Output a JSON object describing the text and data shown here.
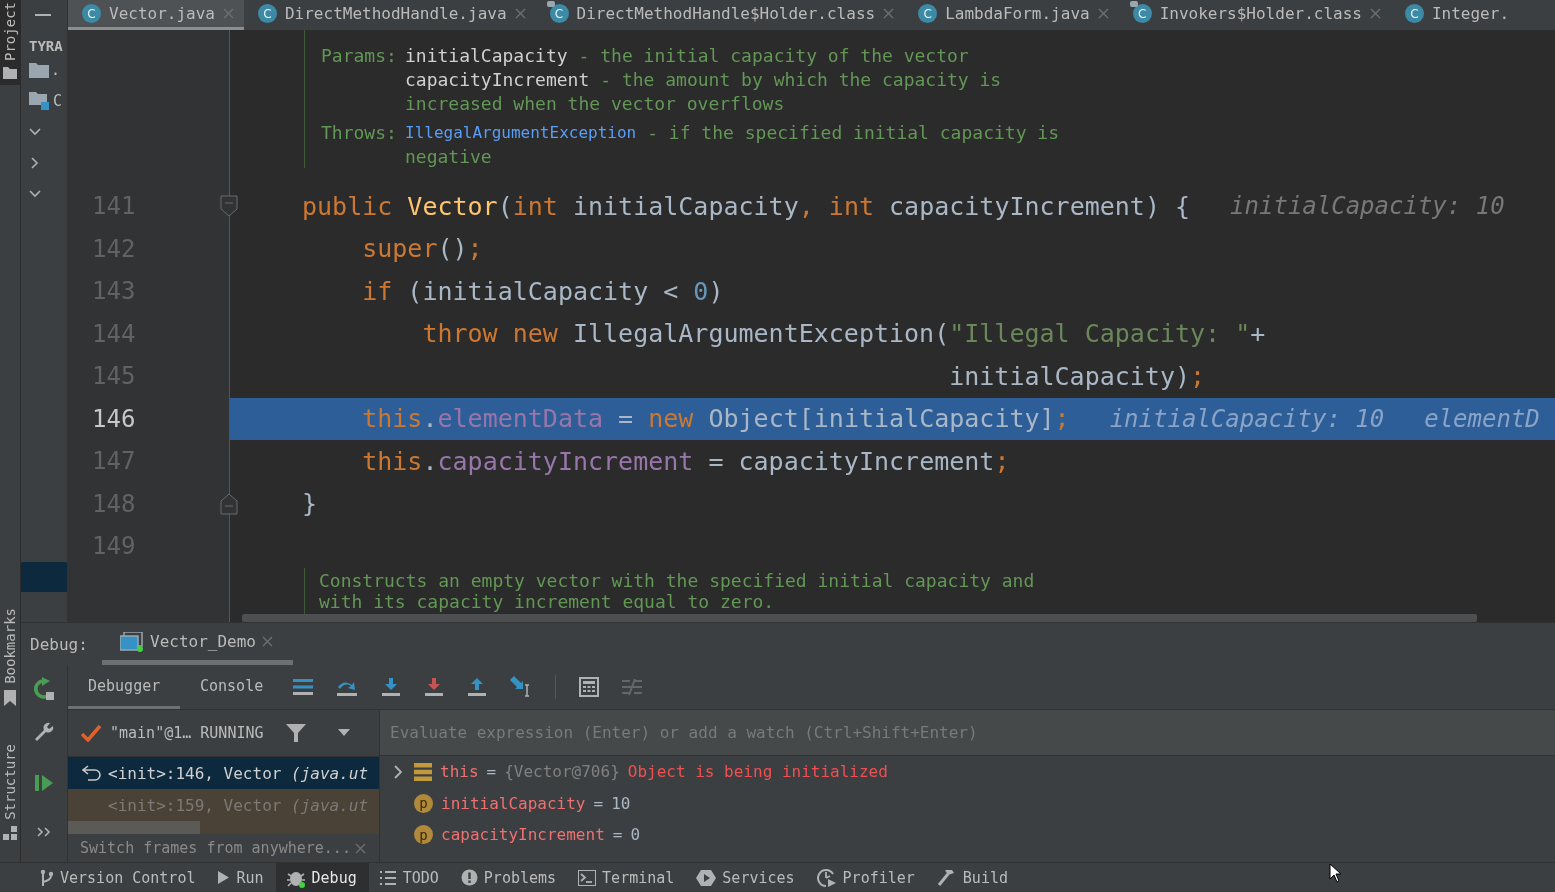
{
  "tool_stripe": {
    "top": [
      {
        "label": "Project",
        "selected": true
      }
    ],
    "bottom": [
      {
        "label": "Bookmarks",
        "selected": false
      },
      {
        "label": "Structure",
        "selected": false
      }
    ]
  },
  "project_panel": {
    "header": "TYRA",
    "items": [
      {
        "kind": "folder",
        "label": "."
      },
      {
        "kind": "module",
        "label": "C"
      },
      {
        "kind": "toggle",
        "expanded": true
      },
      {
        "kind": "toggle",
        "expanded": false
      },
      {
        "kind": "toggle",
        "expanded": true
      }
    ]
  },
  "editor_tabs": [
    {
      "label": "Vector.java",
      "icon_letter": "C",
      "kind": "source",
      "selected": true
    },
    {
      "label": "DirectMethodHandle.java",
      "icon_letter": "C",
      "kind": "source",
      "selected": false
    },
    {
      "label": "DirectMethodHandle$Holder.class",
      "icon_letter": "C",
      "kind": "compiled",
      "selected": false
    },
    {
      "label": "LambdaForm.java",
      "icon_letter": "C",
      "kind": "source",
      "selected": false
    },
    {
      "label": "Invokers$Holder.class",
      "icon_letter": "C",
      "kind": "compiled",
      "selected": false
    },
    {
      "label": "Integer.",
      "icon_letter": "C",
      "kind": "source",
      "selected": false
    }
  ],
  "doc_top": {
    "rows": [
      {
        "label": "Params:",
        "entries": [
          {
            "term": "initialCapacity",
            "kind": "param",
            "lines": [
              "- the initial capacity of the vector"
            ]
          },
          {
            "term": "capacityIncrement",
            "kind": "param",
            "lines": [
              "- the amount by which the capacity is",
              "increased when the vector overflows"
            ]
          }
        ]
      },
      {
        "label": "Throws:",
        "entries": [
          {
            "term": "IllegalArgumentException",
            "kind": "link",
            "lines": [
              "- if the specified initial capacity is",
              "negative"
            ]
          }
        ]
      }
    ]
  },
  "code_lines": [
    {
      "number": "141",
      "kind": "fold_start",
      "current": false,
      "tokens": [
        {
          "text": "public",
          "kind": "keyword"
        },
        {
          "text": " Vector",
          "kind": "declaration"
        },
        {
          "text": "(",
          "kind": "plain"
        },
        {
          "text": "int",
          "kind": "keyword"
        },
        {
          "text": " initialCapacity",
          "kind": "plain"
        },
        {
          "text": ",",
          "kind": "keyword"
        },
        {
          "text": " int",
          "kind": "keyword"
        },
        {
          "text": " capacityIncrement) {",
          "kind": "plain"
        }
      ],
      "hints": [
        "initialCapacity: 10"
      ]
    },
    {
      "number": "142",
      "kind": "plain",
      "current": false,
      "tokens": [
        {
          "text": "    super",
          "kind": "keyword"
        },
        {
          "text": "()",
          "kind": "plain"
        },
        {
          "text": ";",
          "kind": "keyword"
        }
      ]
    },
    {
      "number": "143",
      "kind": "plain",
      "current": false,
      "tokens": [
        {
          "text": "    if",
          "kind": "keyword"
        },
        {
          "text": " (initialCapacity < ",
          "kind": "plain"
        },
        {
          "text": "0",
          "kind": "number"
        },
        {
          "text": ")",
          "kind": "plain"
        }
      ]
    },
    {
      "number": "144",
      "kind": "plain",
      "current": false,
      "tokens": [
        {
          "text": "        throw new",
          "kind": "keyword"
        },
        {
          "text": " IllegalArgumentException(",
          "kind": "plain"
        },
        {
          "text": "\"Illegal Capacity: \"",
          "kind": "string"
        },
        {
          "text": "+",
          "kind": "plain"
        }
      ]
    },
    {
      "number": "145",
      "kind": "plain",
      "current": false,
      "tokens": [
        {
          "text": "                                           initialCapacity)",
          "kind": "plain"
        },
        {
          "text": ";",
          "kind": "keyword"
        }
      ]
    },
    {
      "number": "146",
      "kind": "plain",
      "current": true,
      "tokens": [
        {
          "text": "    this",
          "kind": "keyword"
        },
        {
          "text": ".",
          "kind": "plain"
        },
        {
          "text": "elementData",
          "kind": "field"
        },
        {
          "text": " = ",
          "kind": "plain"
        },
        {
          "text": "new",
          "kind": "keyword"
        },
        {
          "text": " Object[initialCapacity]",
          "kind": "plain"
        },
        {
          "text": ";",
          "kind": "keyword"
        }
      ],
      "hints": [
        "initialCapacity: 10",
        "elementD"
      ]
    },
    {
      "number": "147",
      "kind": "plain",
      "current": false,
      "tokens": [
        {
          "text": "    this",
          "kind": "keyword"
        },
        {
          "text": ".",
          "kind": "plain"
        },
        {
          "text": "capacityIncrement",
          "kind": "field"
        },
        {
          "text": " = capacityIncrement",
          "kind": "plain"
        },
        {
          "text": ";",
          "kind": "keyword"
        }
      ]
    },
    {
      "number": "148",
      "kind": "fold_end",
      "current": false,
      "tokens": [
        {
          "text": "}",
          "kind": "plain"
        }
      ]
    },
    {
      "number": "149",
      "kind": "plain",
      "current": false
    }
  ],
  "doc_bottom": {
    "lines": [
      "Constructs an empty vector with the specified initial capacity and",
      "with its capacity increment equal to zero."
    ]
  },
  "debug": {
    "title": "Debug:",
    "session_tab": {
      "label": "Vector_Demo",
      "selected": true
    },
    "side_actions": [
      {
        "kind": "rerun"
      },
      {
        "kind": "settings"
      },
      {
        "kind": "resume"
      },
      {
        "kind": "more"
      }
    ],
    "tabs": [
      {
        "label": "Debugger",
        "selected": true
      },
      {
        "label": "Console",
        "selected": false
      }
    ],
    "toolbar": [
      {
        "kind": "layout",
        "disabled": false
      },
      {
        "kind": "step_over",
        "disabled": false
      },
      {
        "kind": "step_into",
        "disabled": false
      },
      {
        "kind": "force_step_into",
        "disabled": false
      },
      {
        "kind": "step_out",
        "disabled": false
      },
      {
        "kind": "run_to_cursor",
        "disabled": false
      },
      {
        "kind": "evaluate",
        "disabled": false
      },
      {
        "kind": "trace",
        "disabled": true
      }
    ],
    "thread": {
      "label": "\"main\"@1… RUNNING"
    },
    "frames": [
      {
        "text": "<init>:146, Vector *(java.ut*",
        "selected": true,
        "library": false
      },
      {
        "text": "<init>:159, Vector *(java.ut*",
        "selected": false,
        "library": true
      }
    ],
    "frames_hint": "Switch frames from anywhere...",
    "evaluate": {
      "placeholder": "Evaluate expression (Enter) or add a watch (Ctrl+Shift+Enter)"
    },
    "variables": [
      {
        "kind": "object",
        "name": "this",
        "sign": "=",
        "value": "{Vector@706}",
        "note": "Object is being initialized",
        "expanded": false
      },
      {
        "kind": "param",
        "badge": "p",
        "name": "initialCapacity",
        "sign": "=",
        "value": "10"
      },
      {
        "kind": "param",
        "badge": "p",
        "name": "capacityIncrement",
        "sign": "=",
        "value": "0"
      }
    ]
  },
  "status_bar": [
    {
      "label": "Version Control",
      "kind": "vcs",
      "selected": false
    },
    {
      "label": "Run",
      "kind": "run",
      "selected": false
    },
    {
      "label": "Debug",
      "kind": "debug",
      "selected": true
    },
    {
      "label": "TODO",
      "kind": "todo",
      "selected": false
    },
    {
      "label": "Problems",
      "kind": "problems",
      "selected": false
    },
    {
      "label": "Terminal",
      "kind": "terminal",
      "selected": false
    },
    {
      "label": "Services",
      "kind": "services",
      "selected": false
    },
    {
      "label": "Profiler",
      "kind": "profiler",
      "selected": false
    },
    {
      "label": "Build",
      "kind": "build",
      "selected": false
    }
  ]
}
